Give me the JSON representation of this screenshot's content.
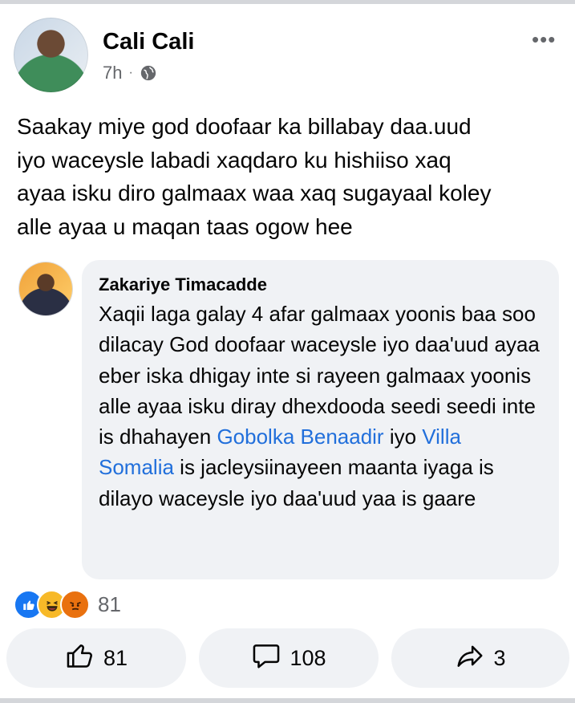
{
  "post": {
    "author": "Cali Cali",
    "time": "7h",
    "separator": "·",
    "text": "Saakay miye god doofaar ka billabay daa.uud\niyo waceysle labadi xaqdaro ku hishiiso  xaq\nayaa isku diro galmaax waa xaq sugayaal koley\nalle ayaa u maqan taas ogow hee"
  },
  "comment": {
    "author": "Zakariye Timacadde",
    "text_1": "Xaqii laga galay 4 afar galmaax yoonis baa soo dilacay God doofaar waceysle iyo daa'uud ayaa eber iska dhigay inte si rayeen galmaax yoonis alle ayaa isku diray dhexdooda seedi seedi inte is dhahayen ",
    "link_1": "Gobolka Benaadir",
    "text_2": " iyo ",
    "link_2": "Villa Somalia",
    "text_3": " is jacleysiinayeen maanta iyaga is dilayo waceysle iyo daa'uud yaa is gaare"
  },
  "reactions": {
    "icons": [
      "like-reaction-icon",
      "haha-reaction-icon",
      "angry-reaction-icon"
    ],
    "count": "81"
  },
  "actions": {
    "like_count": "81",
    "comment_count": "108",
    "share_count": "3"
  },
  "colors": {
    "link": "#216fdb",
    "secondary_text": "#65676b",
    "bubble_bg": "#f0f2f5",
    "like_blue": "#1877f2"
  }
}
